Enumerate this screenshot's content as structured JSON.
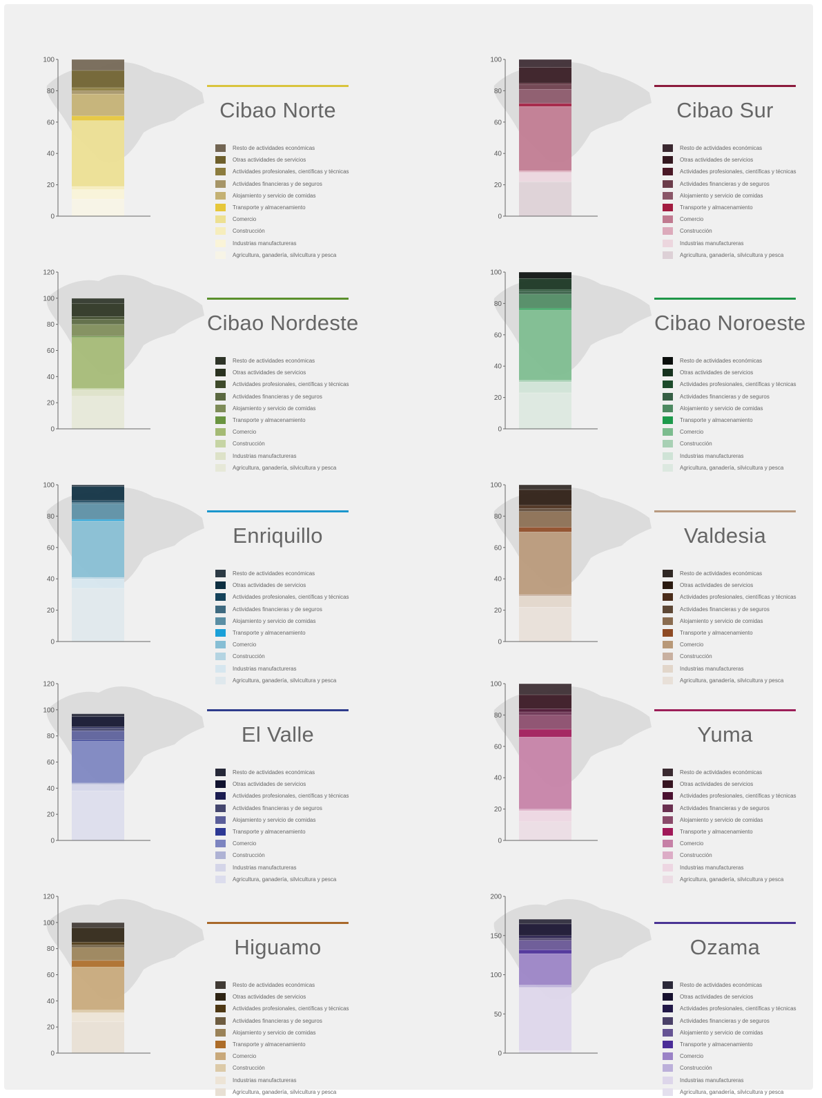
{
  "sectors": [
    "Resto de actividades económicas",
    "Otras actividades de servicios",
    "Actividades profesionales, científicas y técnicas",
    "Actividades financieras y de seguros",
    "Alojamiento y servicio de comidas",
    "Transporte y almacenamiento",
    "Comercio",
    "Construcción",
    "Industrias manufactureras",
    "Agricultura, ganadería, silvicultura y pesca"
  ],
  "chart_data": [
    {
      "type": "bar",
      "title": "Cibao Norte",
      "accent": "#d9c43c",
      "ylim": [
        0,
        100
      ],
      "ticks": [
        0,
        20,
        40,
        60,
        80,
        100
      ],
      "series": [
        {
          "name": "Agricultura, ganadería, silvicultura y pesca",
          "value": 11,
          "color": "#f7f4e6"
        },
        {
          "name": "Industrias manufactureras",
          "value": 6,
          "color": "#faf4d8"
        },
        {
          "name": "Construcción",
          "value": 2,
          "color": "#f6edbc"
        },
        {
          "name": "Comercio",
          "value": 42,
          "color": "#ede091"
        },
        {
          "name": "Transporte y almacenamiento",
          "value": 3,
          "color": "#e6c73a"
        },
        {
          "name": "Alojamiento y servicio de comidas",
          "value": 14,
          "color": "#c4b173"
        },
        {
          "name": "Actividades financieras y de seguros",
          "value": 2,
          "color": "#a69567"
        },
        {
          "name": "Actividades profesionales, científicas y técnicas",
          "value": 2,
          "color": "#8c7c3e"
        },
        {
          "name": "Otras actividades de servicios",
          "value": 11,
          "color": "#6e5f2c"
        },
        {
          "name": "Resto de actividades económicas",
          "value": 7,
          "color": "#726553"
        }
      ]
    },
    {
      "type": "bar",
      "title": "Cibao Sur",
      "accent": "#8c1a3c",
      "ylim": [
        0,
        100
      ],
      "ticks": [
        0,
        20,
        40,
        60,
        80,
        100
      ],
      "series": [
        {
          "name": "Agricultura, ganadería, silvicultura y pesca",
          "value": 22,
          "color": "#ddd0d6"
        },
        {
          "name": "Industrias manufactureras",
          "value": 6,
          "color": "#ecd6de"
        },
        {
          "name": "Construcción",
          "value": 1,
          "color": "#dcaabb"
        },
        {
          "name": "Comercio",
          "value": 41,
          "color": "#c07a90"
        },
        {
          "name": "Transporte y almacenamiento",
          "value": 2,
          "color": "#a21c40"
        },
        {
          "name": "Alojamiento y servicio de comidas",
          "value": 9,
          "color": "#8a5668"
        },
        {
          "name": "Actividades financieras y de seguros",
          "value": 3,
          "color": "#6b3c4a"
        },
        {
          "name": "Actividades profesionales, científicas y técnicas",
          "value": 1,
          "color": "#4a1826"
        },
        {
          "name": "Otras actividades de servicios",
          "value": 10,
          "color": "#341820"
        },
        {
          "name": "Resto de actividades económicas",
          "value": 5,
          "color": "#3a2830"
        }
      ]
    },
    {
      "type": "bar",
      "title": "Cibao Nordeste",
      "accent": "#5a8f2c",
      "ylim": [
        0,
        120
      ],
      "ticks": [
        0,
        20,
        40,
        60,
        80,
        100,
        120
      ],
      "series": [
        {
          "name": "Agricultura, ganadería, silvicultura y pesca",
          "value": 25,
          "color": "#e6e8d8"
        },
        {
          "name": "Industrias manufactureras",
          "value": 5,
          "color": "#dde2c8"
        },
        {
          "name": "Construcción",
          "value": 1,
          "color": "#c6d4a4"
        },
        {
          "name": "Comercio",
          "value": 39,
          "color": "#a4ba74"
        },
        {
          "name": "Transporte y almacenamiento",
          "value": 1,
          "color": "#6a9440"
        },
        {
          "name": "Alojamiento y servicio de comidas",
          "value": 9,
          "color": "#7e8c58"
        },
        {
          "name": "Actividades financieras y de seguros",
          "value": 4,
          "color": "#5a6840"
        },
        {
          "name": "Actividades profesionales, científicas y técnicas",
          "value": 2,
          "color": "#3e4a2a"
        },
        {
          "name": "Otras actividades de servicios",
          "value": 10,
          "color": "#2a3220"
        },
        {
          "name": "Resto de actividades económicas",
          "value": 4,
          "color": "#2e3428"
        }
      ]
    },
    {
      "type": "bar",
      "title": "Cibao Noroeste",
      "accent": "#1e9648",
      "ylim": [
        0,
        100
      ],
      "ticks": [
        0,
        20,
        40,
        60,
        80,
        100
      ],
      "series": [
        {
          "name": "Agricultura, ganadería, silvicultura y pesca",
          "value": 23,
          "color": "#dce8e0"
        },
        {
          "name": "Industrias manufactureras",
          "value": 7,
          "color": "#cfe3d6"
        },
        {
          "name": "Construcción",
          "value": 1,
          "color": "#a8d0b4"
        },
        {
          "name": "Comercio",
          "value": 45,
          "color": "#7cbc8e"
        },
        {
          "name": "Transporte y almacenamiento",
          "value": 1,
          "color": "#1e9a4c"
        },
        {
          "name": "Alojamiento y servicio de comidas",
          "value": 9,
          "color": "#4e8a62"
        },
        {
          "name": "Actividades financieras y de seguros",
          "value": 2,
          "color": "#355e44"
        },
        {
          "name": "Actividades profesionales, científicas y técnicas",
          "value": 1,
          "color": "#1c4a2a"
        },
        {
          "name": "Otras actividades de servicios",
          "value": 7,
          "color": "#16321e"
        },
        {
          "name": "Resto de actividades económicas",
          "value": 4,
          "color": "#0a0e0c"
        }
      ]
    },
    {
      "type": "bar",
      "title": "Enriquillo",
      "accent": "#1a96cc",
      "ylim": [
        0,
        100
      ],
      "ticks": [
        0,
        20,
        40,
        60,
        80,
        100
      ],
      "series": [
        {
          "name": "Agricultura, ganadería, silvicultura y pesca",
          "value": 34,
          "color": "#dfe8ed"
        },
        {
          "name": "Industrias manufactureras",
          "value": 6,
          "color": "#d6e6ef"
        },
        {
          "name": "Construcción",
          "value": 1,
          "color": "#b4d4e2"
        },
        {
          "name": "Comercio",
          "value": 36,
          "color": "#86bed4"
        },
        {
          "name": "Transporte y almacenamiento",
          "value": 1,
          "color": "#1aa0d8"
        },
        {
          "name": "Alojamiento y servicio de comidas",
          "value": 10,
          "color": "#5a8ea4"
        },
        {
          "name": "Actividades financieras y de seguros",
          "value": 1,
          "color": "#3e6a80"
        },
        {
          "name": "Actividades profesionales, científicas y técnicas",
          "value": 1,
          "color": "#14425a"
        },
        {
          "name": "Otras actividades de servicios",
          "value": 9,
          "color": "#0c2e40"
        },
        {
          "name": "Resto de actividades económicas",
          "value": 1,
          "color": "#2c3a44"
        }
      ]
    },
    {
      "type": "bar",
      "title": "Valdesia",
      "accent": "#b89a80",
      "ylim": [
        0,
        100
      ],
      "ticks": [
        0,
        20,
        40,
        60,
        80,
        100
      ],
      "series": [
        {
          "name": "Agricultura, ganadería, silvicultura y pesca",
          "value": 22,
          "color": "#e8e0d8"
        },
        {
          "name": "Industrias manufactureras",
          "value": 7,
          "color": "#e2d6ca"
        },
        {
          "name": "Construcción",
          "value": 1,
          "color": "#c8b0a0"
        },
        {
          "name": "Comercio",
          "value": 40,
          "color": "#b89878"
        },
        {
          "name": "Transporte y almacenamiento",
          "value": 3,
          "color": "#8e4a24"
        },
        {
          "name": "Alojamiento y servicio de comidas",
          "value": 10,
          "color": "#8a6c50"
        },
        {
          "name": "Actividades financieras y de seguros",
          "value": 2,
          "color": "#5e4836"
        },
        {
          "name": "Actividades profesionales, científicas y técnicas",
          "value": 2,
          "color": "#4a2c1a"
        },
        {
          "name": "Otras actividades de servicios",
          "value": 10,
          "color": "#2a1a10"
        },
        {
          "name": "Resto de actividades económicas",
          "value": 3,
          "color": "#302824"
        }
      ]
    },
    {
      "type": "bar",
      "title": "El Valle",
      "accent": "#2e3c8c",
      "ylim": [
        0,
        120
      ],
      "ticks": [
        0,
        20,
        40,
        60,
        80,
        100,
        120
      ],
      "series": [
        {
          "name": "Agricultura, ganadería, silvicultura y pesca",
          "value": 38,
          "color": "#dcdded"
        },
        {
          "name": "Industrias manufactureras",
          "value": 5,
          "color": "#d4d5e8"
        },
        {
          "name": "Construcción",
          "value": 1,
          "color": "#aeb2d4"
        },
        {
          "name": "Comercio",
          "value": 32,
          "color": "#7c84c0"
        },
        {
          "name": "Transporte y almacenamiento",
          "value": 1,
          "color": "#2c3894"
        },
        {
          "name": "Alojamiento y servicio de comidas",
          "value": 7,
          "color": "#5a5e9a"
        },
        {
          "name": "Actividades financieras y de seguros",
          "value": 2,
          "color": "#44466e"
        },
        {
          "name": "Actividades profesionales, científicas y técnicas",
          "value": 1,
          "color": "#1a1c50"
        },
        {
          "name": "Otras actividades de servicios",
          "value": 8,
          "color": "#10122e"
        },
        {
          "name": "Resto de actividades económicas",
          "value": 2,
          "color": "#262838"
        }
      ]
    },
    {
      "type": "bar",
      "title": "Yuma",
      "accent": "#9c1e58",
      "ylim": [
        0,
        100
      ],
      "ticks": [
        0,
        20,
        40,
        60,
        80,
        100
      ],
      "series": [
        {
          "name": "Agricultura, ganadería, silvicultura y pesca",
          "value": 12,
          "color": "#ecdce4"
        },
        {
          "name": "Industrias manufactureras",
          "value": 7,
          "color": "#edd6e2"
        },
        {
          "name": "Construcción",
          "value": 1,
          "color": "#dcacc6"
        },
        {
          "name": "Comercio",
          "value": 46,
          "color": "#c680a6"
        },
        {
          "name": "Transporte y almacenamiento",
          "value": 5,
          "color": "#a01858"
        },
        {
          "name": "Alojamiento y servicio de comidas",
          "value": 9,
          "color": "#8a4a6a"
        },
        {
          "name": "Actividades financieras y de seguros",
          "value": 2,
          "color": "#6a3050"
        },
        {
          "name": "Actividades profesionales, científicas y técnicas",
          "value": 2,
          "color": "#4a1030"
        },
        {
          "name": "Otras actividades de servicios",
          "value": 9,
          "color": "#361420"
        },
        {
          "name": "Resto de actividades económicas",
          "value": 7,
          "color": "#3a2a30"
        }
      ]
    },
    {
      "type": "bar",
      "title": "Higuamo",
      "accent": "#a8682a",
      "ylim": [
        0,
        120
      ],
      "ticks": [
        0,
        20,
        40,
        60,
        80,
        100,
        120
      ],
      "series": [
        {
          "name": "Agricultura, ganadería, silvicultura y pesca",
          "value": 24,
          "color": "#e8e0d4"
        },
        {
          "name": "Industrias manufactureras",
          "value": 7,
          "color": "#ede4d6"
        },
        {
          "name": "Construcción",
          "value": 2,
          "color": "#dccaa8"
        },
        {
          "name": "Comercio",
          "value": 33,
          "color": "#c8a87a"
        },
        {
          "name": "Transporte y almacenamiento",
          "value": 5,
          "color": "#ac6c28"
        },
        {
          "name": "Alojamiento y servicio de comidas",
          "value": 10,
          "color": "#9a8258"
        },
        {
          "name": "Actividades financieras y de seguros",
          "value": 2,
          "color": "#6e5c40"
        },
        {
          "name": "Actividades profesionales, científicas y técnicas",
          "value": 2,
          "color": "#4e3814"
        },
        {
          "name": "Otras actividades de servicios",
          "value": 11,
          "color": "#2e2414"
        },
        {
          "name": "Resto de actividades económicas",
          "value": 4,
          "color": "#403a34"
        }
      ]
    },
    {
      "type": "bar",
      "title": "Ozama",
      "accent": "#4a3494",
      "ylim": [
        0,
        200
      ],
      "ticks": [
        0,
        50,
        100,
        150,
        200
      ],
      "series": [
        {
          "name": "Agricultura, ganadería, silvicultura y pesca",
          "value": 3,
          "color": "#e4e0ee"
        },
        {
          "name": "Industrias manufactureras",
          "value": 81,
          "color": "#ddd6ea"
        },
        {
          "name": "Construcción",
          "value": 3,
          "color": "#bcb0da"
        },
        {
          "name": "Comercio",
          "value": 40,
          "color": "#9a82c6"
        },
        {
          "name": "Transporte y almacenamiento",
          "value": 5,
          "color": "#4a2c98"
        },
        {
          "name": "Alojamiento y servicio de comidas",
          "value": 12,
          "color": "#665494"
        },
        {
          "name": "Actividades financieras y de seguros",
          "value": 3,
          "color": "#4a4068"
        },
        {
          "name": "Actividades profesionales, científicas y técnicas",
          "value": 3,
          "color": "#221848"
        },
        {
          "name": "Otras actividades de servicios",
          "value": 15,
          "color": "#16102e"
        },
        {
          "name": "Resto de actividades económicas",
          "value": 6,
          "color": "#2a2838"
        }
      ]
    }
  ]
}
